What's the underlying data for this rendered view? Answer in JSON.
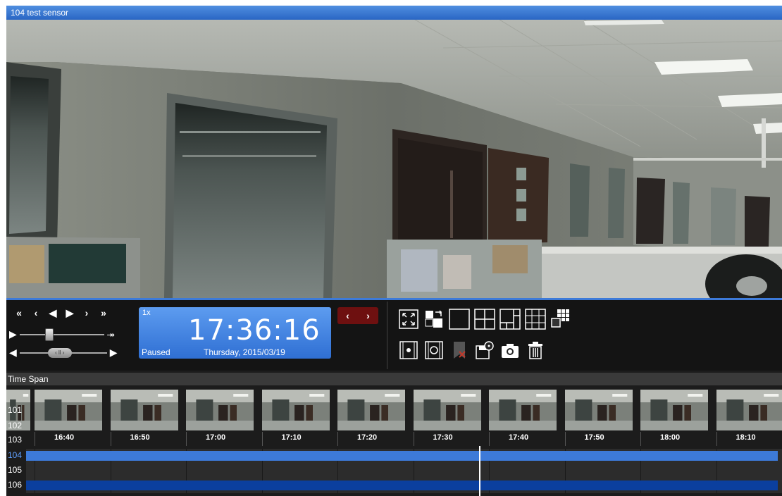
{
  "window": {
    "title": "104 test sensor"
  },
  "playback": {
    "nav_buttons": [
      "«",
      "‹",
      "◀",
      "▶",
      "›",
      "»"
    ],
    "speed_slider_end_icon": "fast-forward-icon",
    "time_slider_label": "‹ ll ›",
    "speed": "1x",
    "time": "17:36:16",
    "status": "Paused",
    "date": "Thursday, 2015/03/19",
    "prev_label": "‹",
    "next_label": "›"
  },
  "toolbar": {
    "row1": [
      "fullscreen-icon",
      "swap-view-icon",
      "layout-1x1-icon",
      "layout-2x2-icon",
      "layout-1plus3-icon",
      "layout-3x3-icon",
      "layout-custom-icon"
    ],
    "row2": [
      "clip-start-icon",
      "clip-end-icon",
      "clear-marker-icon",
      "export-icon",
      "snapshot-icon",
      "delete-icon"
    ]
  },
  "timeline": {
    "header": "Time Span",
    "channels": [
      "101",
      "102",
      "103",
      "104",
      "105",
      "106"
    ],
    "ticks": [
      "16:40",
      "16:50",
      "17:00",
      "17:10",
      "17:20",
      "17:30",
      "17:40",
      "17:50",
      "18:00",
      "18:10"
    ],
    "recording_fraction": {
      "104": 1.0,
      "106": 1.0
    }
  },
  "colors": {
    "accent": "#2f6fd3",
    "track_104": "#3d7ad8",
    "track_106": "#0b3f9e",
    "prev_next": "#6e1010"
  }
}
